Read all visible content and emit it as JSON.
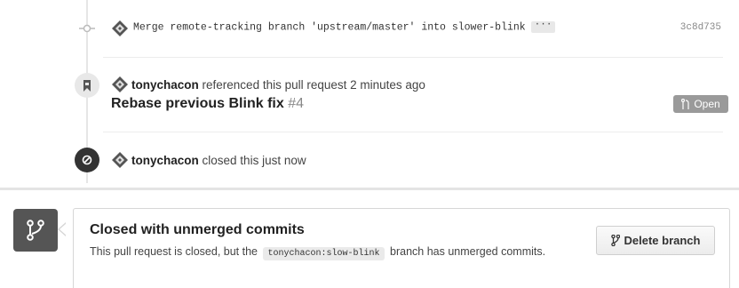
{
  "commit": {
    "message": "Merge remote-tracking branch 'upstream/master' into slower-blink",
    "more": "···",
    "sha": "3c8d735"
  },
  "reference_event": {
    "user": "tonychacon",
    "text": "referenced this pull request 2 minutes ago",
    "pr_title": "Rebase previous Blink fix",
    "pr_number": "#4",
    "status": "Open"
  },
  "closed_event": {
    "user": "tonychacon",
    "text": "closed this just now"
  },
  "merge_box": {
    "title": "Closed with unmerged commits",
    "desc_before": "This pull request is closed, but the",
    "branch": "tonychacon:slow-blink",
    "desc_after": "branch has unmerged commits.",
    "delete_label": "Delete branch"
  }
}
